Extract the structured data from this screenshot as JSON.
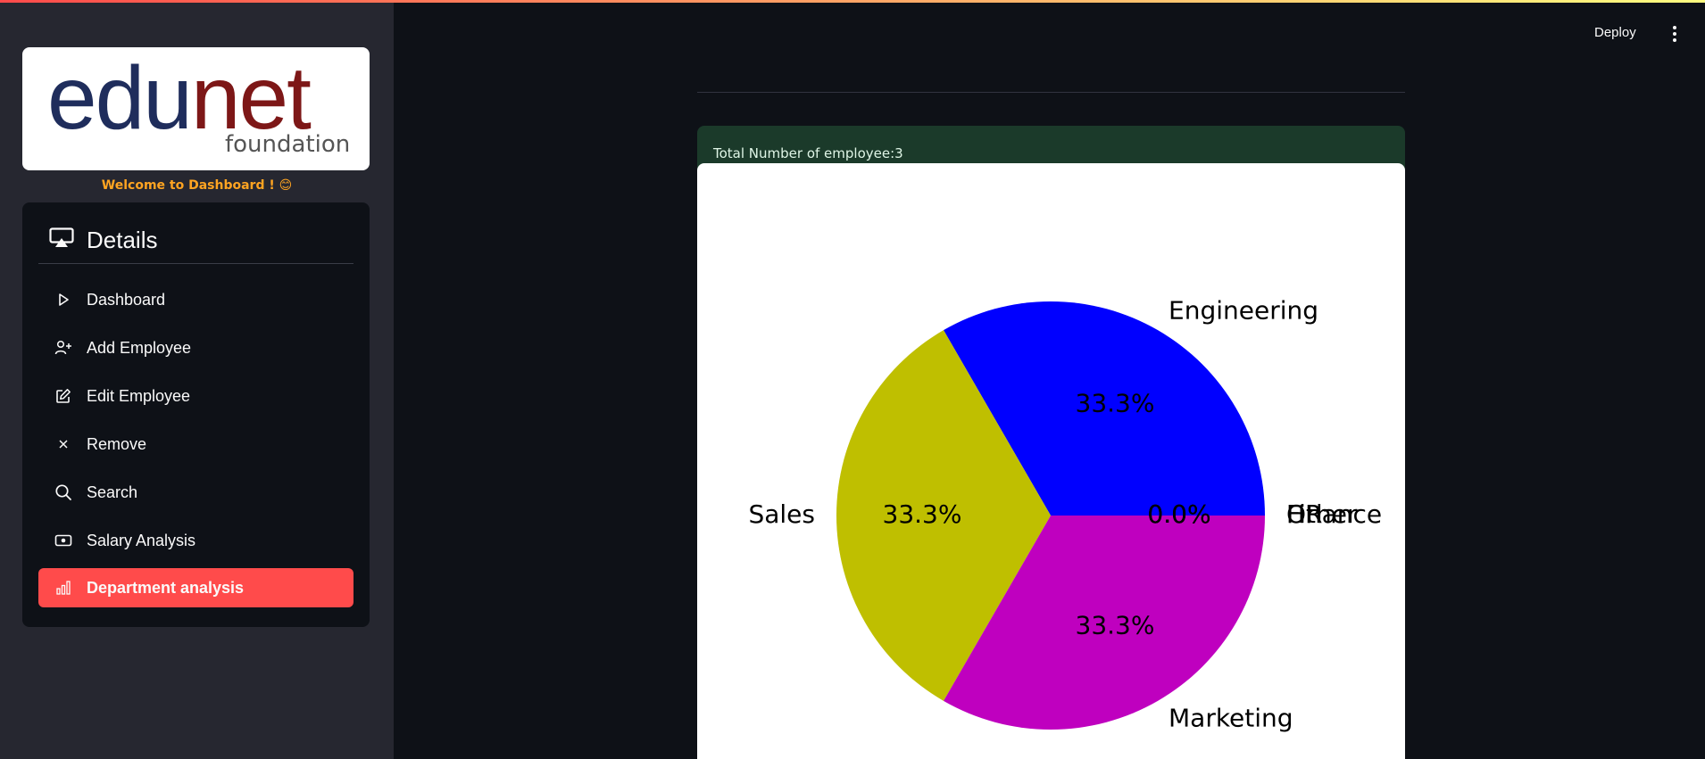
{
  "header": {
    "deploy_label": "Deploy",
    "menu_icon": "kebab-menu-icon"
  },
  "sidebar": {
    "logo": {
      "text_primary": "edu",
      "text_accent": "net",
      "subtitle": "foundation"
    },
    "welcome": "Welcome to Dashboard ! 😊",
    "menu_title": "Details",
    "menu_title_icon": "airplay-icon",
    "items": [
      {
        "label": "Dashboard",
        "icon": "play-outline-icon",
        "active": false
      },
      {
        "label": "Add Employee",
        "icon": "person-add-icon",
        "active": false
      },
      {
        "label": "Edit Employee",
        "icon": "edit-icon",
        "active": false
      },
      {
        "label": "Remove",
        "icon": "close-icon",
        "active": false
      },
      {
        "label": "Search",
        "icon": "search-icon",
        "active": false
      },
      {
        "label": "Salary Analysis",
        "icon": "cash-icon",
        "active": false
      },
      {
        "label": "Department analysis",
        "icon": "bar-chart-icon",
        "active": true
      }
    ],
    "active_color": "#ff4b4b",
    "welcome_color": "#ffa421"
  },
  "main": {
    "info_text": "Total Number of employee:3"
  },
  "chart_data": {
    "type": "pie",
    "start_angle": 0,
    "slices": [
      {
        "label": "Engineering",
        "value": 1,
        "pct": "33.3%",
        "color": "#0000ff"
      },
      {
        "label": "Sales",
        "value": 1,
        "pct": "33.3%",
        "color": "#bfbf00"
      },
      {
        "label": "Marketing",
        "value": 1,
        "pct": "33.3%",
        "color": "#bf00bf"
      },
      {
        "label": "HR",
        "value": 0,
        "pct": "0.0%",
        "color": "#00bfbf"
      },
      {
        "label": "Finance",
        "value": 0,
        "pct": "0.0%",
        "color": "#00bf00"
      },
      {
        "label": "Other",
        "value": 0,
        "pct": "0.0%",
        "color": "#ff0000"
      }
    ]
  }
}
